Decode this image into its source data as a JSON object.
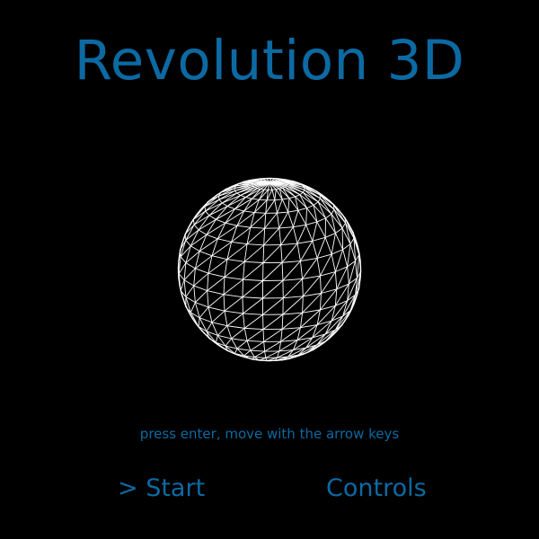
{
  "title": "Revolution 3D",
  "hint": "press enter, move with the arrow keys",
  "menu": {
    "start_label": "> Start",
    "controls_label": "Controls"
  },
  "globe": {
    "icon": "wireframe-sphere-icon",
    "stroke_color": "#ffffff",
    "fill_color": "#000000"
  },
  "colors": {
    "background": "#000000",
    "accent": "#0c6aa3"
  }
}
